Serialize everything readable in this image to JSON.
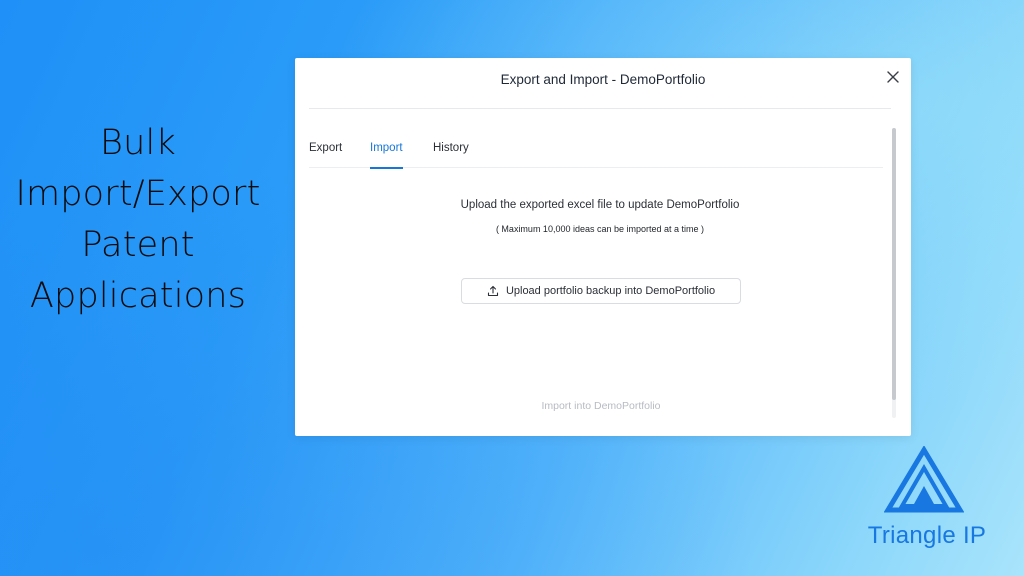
{
  "slide": {
    "headline": [
      "Bulk",
      "Import/Export",
      "Patent",
      "Applications"
    ]
  },
  "dialog": {
    "title": "Export and Import - DemoPortfolio",
    "close_icon": "close-icon",
    "tabs": [
      {
        "label": "Export",
        "active": false
      },
      {
        "label": "Import",
        "active": true
      },
      {
        "label": "History",
        "active": false
      }
    ],
    "import_panel": {
      "instruction": "Upload the exported excel file to update DemoPortfolio",
      "limit_note": "( Maximum 10,000 ideas can be imported at a time )",
      "upload_button_label": "Upload portfolio backup into DemoPortfolio",
      "upload_icon": "upload-icon",
      "import_action_label": "Import into  DemoPortfolio"
    }
  },
  "brand": {
    "name": "Triangle IP",
    "logo_icon": "triangle-logo-icon",
    "accent_color": "#1877e0"
  },
  "colors": {
    "active_tab": "#1677d9",
    "disabled_text": "#b7bbc2"
  }
}
